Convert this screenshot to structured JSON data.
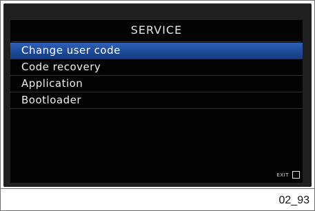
{
  "screen": {
    "title": "SERVICE",
    "menu": [
      {
        "label": "Change user code",
        "selected": true
      },
      {
        "label": "Code recovery",
        "selected": false
      },
      {
        "label": "Application",
        "selected": false
      },
      {
        "label": "Bootloader",
        "selected": false
      }
    ],
    "exit_label": "EXIT"
  },
  "caption": "02_93",
  "colors": {
    "screen_background": "#030303",
    "selection": "#1e4a98",
    "text": "#f0f0f0"
  }
}
